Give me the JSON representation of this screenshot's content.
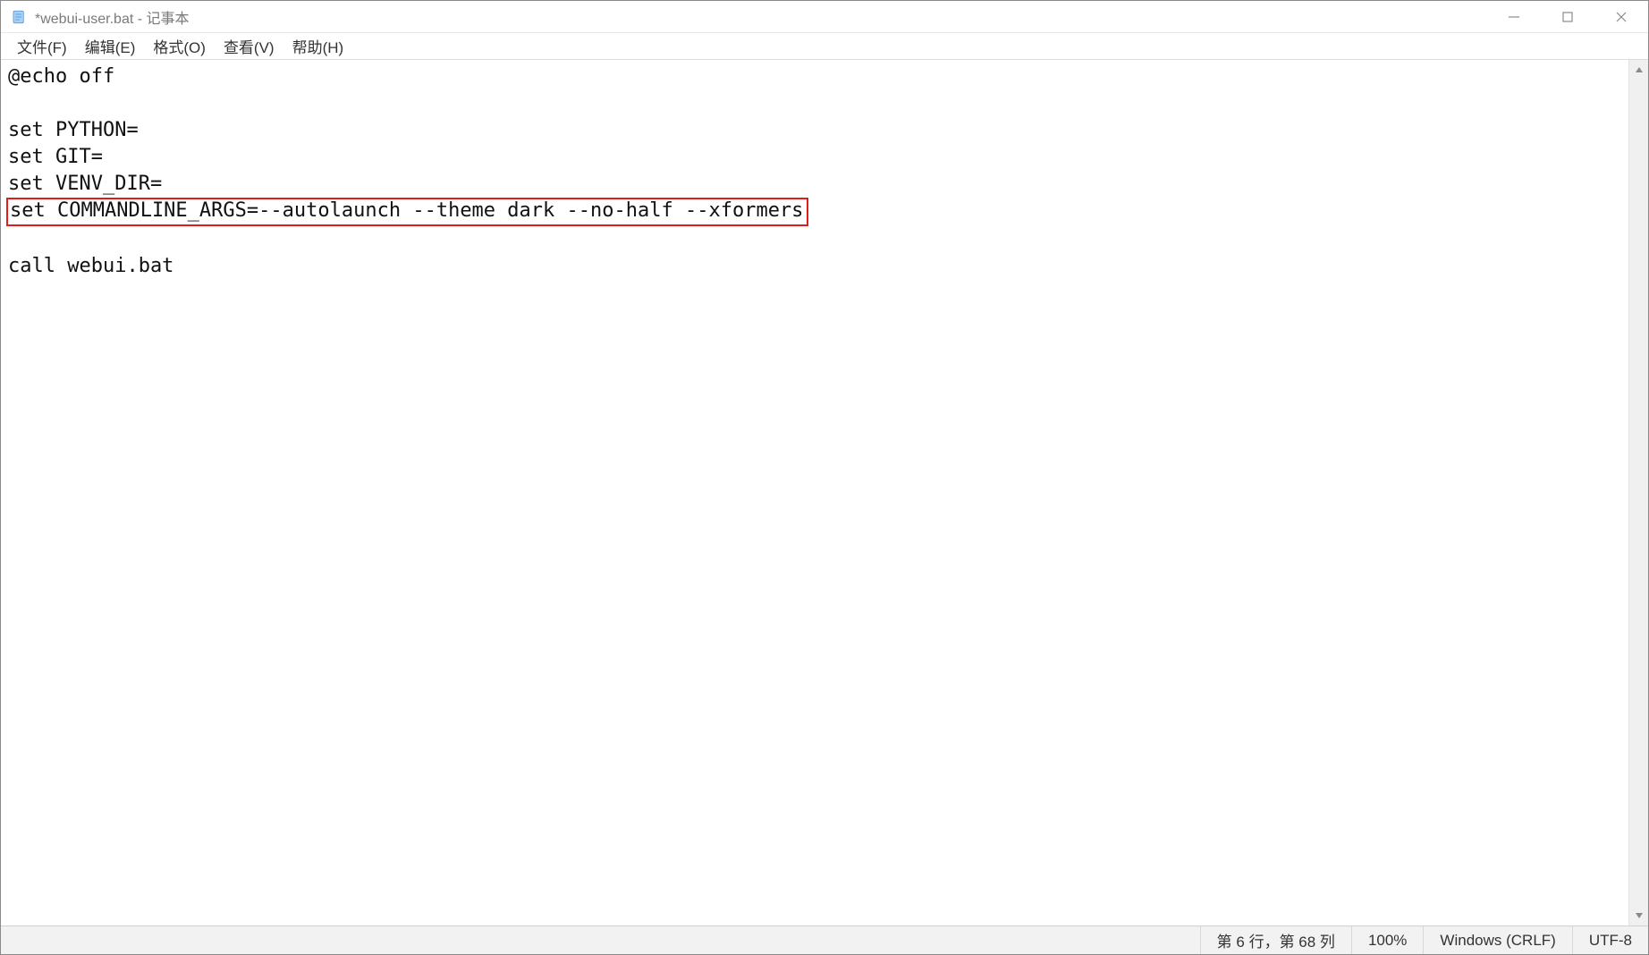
{
  "titlebar": {
    "title": "*webui-user.bat - 记事本"
  },
  "menubar": {
    "items": [
      {
        "label": "文件(F)"
      },
      {
        "label": "编辑(E)"
      },
      {
        "label": "格式(O)"
      },
      {
        "label": "查看(V)"
      },
      {
        "label": "帮助(H)"
      }
    ]
  },
  "editor": {
    "lines": [
      "@echo off",
      "",
      "set PYTHON=",
      "set GIT=",
      "set VENV_DIR=",
      "set COMMANDLINE_ARGS=--autolaunch --theme dark --no-half --xformers",
      "",
      "call webui.bat"
    ],
    "highlight_line_index": 5
  },
  "statusbar": {
    "position": "第 6 行，第 68 列",
    "zoom": "100%",
    "line_ending": "Windows (CRLF)",
    "encoding": "UTF-8"
  }
}
